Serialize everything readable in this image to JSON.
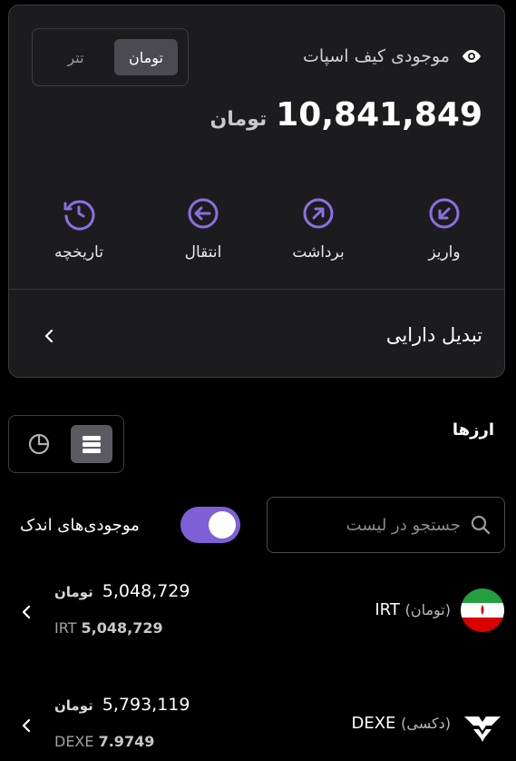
{
  "wallet": {
    "balance_label": "موجودی کیف اسپات",
    "amount": "10,841,849",
    "unit": "تومان",
    "currency_toggle": {
      "toman": "تومان",
      "tether": "تتر",
      "active": "toman"
    }
  },
  "actions": [
    {
      "label": "واریز",
      "icon": "deposit-icon"
    },
    {
      "label": "برداشت",
      "icon": "withdraw-icon"
    },
    {
      "label": "انتقال",
      "icon": "transfer-icon"
    },
    {
      "label": "تاریخچه",
      "icon": "history-icon"
    }
  ],
  "convert": {
    "label": "تبدیل دارایی"
  },
  "currencies": {
    "title": "ارزها",
    "search_placeholder": "جستجو در لیست",
    "small_balances_label": "موجودی‌های اندک",
    "small_balances_on": true,
    "view": "list"
  },
  "assets": [
    {
      "symbol": "IRT",
      "name": "(تومان)",
      "value": "5,048,729",
      "unit": "تومان",
      "amount_prefix": "IRT",
      "amount": "5,048,729",
      "icon": "iran-flag-icon"
    },
    {
      "symbol": "DEXE",
      "name": "(دکسی)",
      "value": "5,793,119",
      "unit": "تومان",
      "amount_prefix": "DEXE",
      "amount": "7.9749",
      "icon": "dexe-logo-icon"
    }
  ],
  "colors": {
    "accent": "#7f5fd6",
    "card_bg": "#1c1c1f",
    "background": "#000000"
  }
}
